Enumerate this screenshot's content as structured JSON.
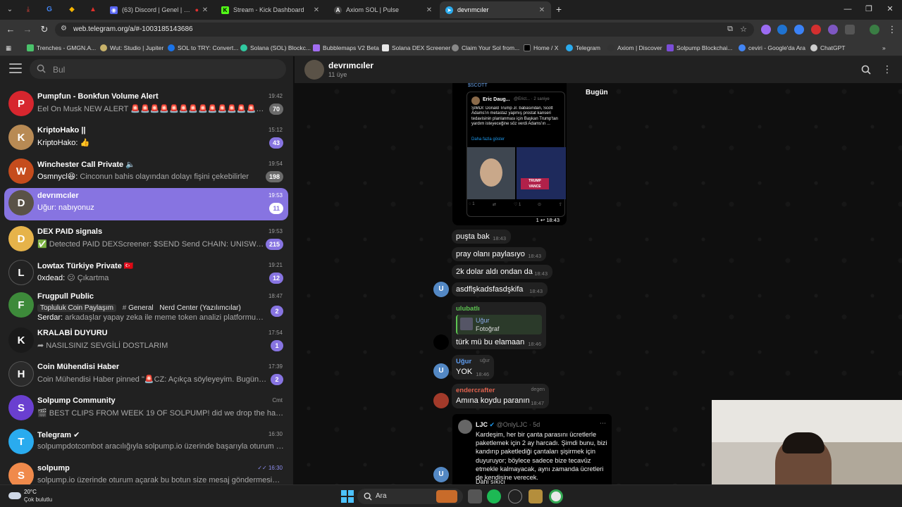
{
  "browser": {
    "tabs": [
      {
        "title": "(63) Discord | Genel | emir.i",
        "color": "#5865f2"
      },
      {
        "title": "Stream - Kick Dashboard",
        "color": "#53fc18"
      },
      {
        "title": "Axiom SOL | Pulse",
        "color": "#444444"
      },
      {
        "title": "devrımcıler",
        "color": "#2aabee"
      }
    ],
    "new_tab": "+",
    "url": "web.telegram.org/a/#-1003185143686",
    "bookmarks": [
      "Trenches - GMGN.A...",
      "Wut: Studio | Jupiter",
      "SOL to TRY: Convert...",
      "Solana (SOL) Blockc...",
      "Bubblemaps V2 Beta",
      "Solana DEX Screener",
      "Claim Your Sol from...",
      "Home / X",
      "Telegram",
      "Axiom | Discover",
      "Solpump Blockchai...",
      "ceviri - Google'da Ara",
      "ChatGPT"
    ]
  },
  "sidebar": {
    "search_placeholder": "Bul",
    "chats": [
      {
        "name": "Pumpfun - Bonkfun Volume Alert",
        "time": "19:42",
        "preview": "Eel On Musk NEW ALERT 🚨🚨🚨🚨🚨🚨🚨🚨🚨🚨🚨🚨🚨🚨🚨🚨",
        "badge": "70",
        "muted": true,
        "avatar_color": "#d7262e",
        "initial": "P"
      },
      {
        "name": "KriptoHako ||",
        "time": "15:12",
        "preview_sender": "KriptoHako:",
        "preview": " 👍",
        "badge": "43",
        "muted": false,
        "avatar_color": "#b88a54",
        "initial": "K"
      },
      {
        "name": "Winchester Call Private 🔈",
        "time": "19:54",
        "preview_sender": "Osmnycl😆:",
        "preview": " Cinconun bahis olayından dolayı fişini çekebilirler",
        "badge": "198",
        "muted": true,
        "avatar_color": "#c54c1d",
        "initial": "W"
      },
      {
        "name": "devrımcıler",
        "time": "19:53",
        "preview_sender": "Uğur:",
        "preview": " nabıyonuz",
        "badge": "11",
        "muted": false,
        "avatar_color": "#5a5247",
        "initial": "D"
      },
      {
        "name": "DEX PAID signals",
        "time": "19:53",
        "preview": "✅ Detected PAID DEXScreener: $SEND Send CHAIN: UNISWAP B...",
        "badge": "215",
        "muted": false,
        "avatar_color": "#e6b34a",
        "initial": "D"
      },
      {
        "name": "Lowtax Türkiye Private 🇹🇷",
        "time": "19:21",
        "preview_sender": "0xdead:",
        "preview": " 😕 Çıkartma",
        "badge": "12",
        "muted": false,
        "avatar_color": "#222222",
        "initial": "L"
      },
      {
        "name": "Frugpull Public",
        "time": "18:47",
        "tags": [
          "Topluluk Coin Paylaşım",
          "General",
          "Nerd Center (Yazılımcılar)"
        ],
        "preview_sender": "Serdar:",
        "preview": " arkadaşlar yapay zeka ile meme token analizi platformunu ...",
        "badge": "2",
        "muted": false,
        "avatar_color": "#3d8a3a",
        "initial": "F"
      },
      {
        "name": "KRALABİ DUYURU",
        "time": "17:54",
        "preview": "➦ NASILSINIZ SEVGİLİ DOSTLARIM",
        "badge": "1",
        "muted": false,
        "avatar_color": "#1a1a1a",
        "initial": "K"
      },
      {
        "name": "Coin Mühendisi Haber",
        "time": "17:39",
        "preview": "Coin Mühendisi Haber pinned \"🚨CZ: Açıkça söyleyeyim. Bugün kend...",
        "badge": "2",
        "muted": false,
        "avatar_color": "#2b2b2b",
        "initial": "H"
      },
      {
        "name": "Solpump Community",
        "time": "Cmt",
        "preview": "🎬 BEST CLIPS FROM WEEK 19 OF SOLPUMP! did we drop the hardest ...",
        "badge": "",
        "muted": false,
        "avatar_color": "#6a3fd0",
        "initial": "S"
      },
      {
        "name": "Telegram ✔",
        "time": "16:30",
        "preview": "solpumpdotcombot aracılığıyla solpump.io üzerinde başarıyla oturum a...",
        "badge": "",
        "muted": false,
        "avatar_color": "#2aabee",
        "initial": "T"
      },
      {
        "name": "solpump",
        "time": "✓✓ 16:30",
        "preview": "solpump.io üzerinde oturum açarak bu botun size mesaj göndermesine i...",
        "badge": "",
        "muted": false,
        "avatar_color": "#f08a4b",
        "initial": "S"
      }
    ]
  },
  "chat": {
    "title": "devrımcıler",
    "subtitle": "11 üye",
    "date_chip": "Bugün",
    "tweet": {
      "label": "$SCOTT",
      "author": "Eric Daug...",
      "handle": "@Erict... · 2 saniye",
      "text": "ŞİMDİ: Donald Trump Jr. babasından, Scott Adams'ın metastaz yapmış prostat kanseri tedavisinin planlanması için Başkan Trump'tan yardım isteyeceğine söz verdi Adams'ın ...",
      "more": "Daha fazla göster",
      "stats": [
        "1",
        "",
        "1",
        ""
      ],
      "views": "1",
      "time": "18:43"
    },
    "messages": [
      {
        "text": "puşta bak",
        "time": "18:43"
      },
      {
        "text": "pray olanı paylasıyo",
        "time": "18:43"
      },
      {
        "text": "2k dolar aldı ondan da",
        "time": "18:43"
      },
      {
        "text": "asdflşkadsfasdşkifa",
        "time": "18:43",
        "avatar": "U"
      },
      {
        "sender": "ulubatlı",
        "reply_name": "Uğur",
        "reply_text": "Fotoğraf",
        "text": "türk mü bu elamaan",
        "time": "18:46"
      },
      {
        "sender": "Uğur",
        "sender_tag": "uğur",
        "text": "YOK",
        "time": "18:46",
        "avatar": "U"
      },
      {
        "sender": "endercrafter",
        "sender_tag": "degen",
        "text": "Amına koydu paranın",
        "time": "18:47"
      }
    ],
    "bottom_tweet": {
      "author": "LJC",
      "handle": "@OnlyLJC · 5d",
      "text": "Kardeşim, her bir çanta parasını ücretlerle paketlemek için 2 ay harcadı. Şimdi bunu, bizi kandırıp paketlediği çantaları şişirmek için duyuruyor; böylece sadece bize tecavüz etmekle kalmayacak, aynı zamanda ücretleri de kendisine verecek.",
      "cut": "Dahi sıkıcı"
    }
  },
  "taskbar": {
    "weather_temp": "20°C",
    "weather_desc": "Çok bulutlu",
    "search_label": "Ara"
  }
}
